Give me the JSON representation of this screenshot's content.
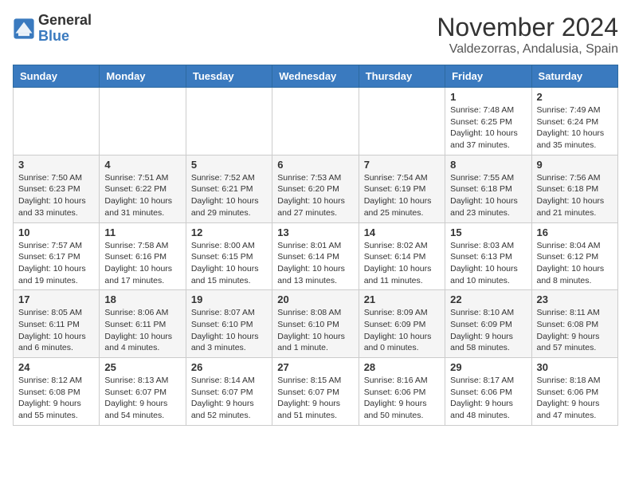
{
  "logo": {
    "general": "General",
    "blue": "Blue"
  },
  "title": {
    "month": "November 2024",
    "location": "Valdezorras, Andalusia, Spain"
  },
  "headers": [
    "Sunday",
    "Monday",
    "Tuesday",
    "Wednesday",
    "Thursday",
    "Friday",
    "Saturday"
  ],
  "weeks": [
    [
      {
        "day": "",
        "info": ""
      },
      {
        "day": "",
        "info": ""
      },
      {
        "day": "",
        "info": ""
      },
      {
        "day": "",
        "info": ""
      },
      {
        "day": "",
        "info": ""
      },
      {
        "day": "1",
        "info": "Sunrise: 7:48 AM\nSunset: 6:25 PM\nDaylight: 10 hours and 37 minutes."
      },
      {
        "day": "2",
        "info": "Sunrise: 7:49 AM\nSunset: 6:24 PM\nDaylight: 10 hours and 35 minutes."
      }
    ],
    [
      {
        "day": "3",
        "info": "Sunrise: 7:50 AM\nSunset: 6:23 PM\nDaylight: 10 hours and 33 minutes."
      },
      {
        "day": "4",
        "info": "Sunrise: 7:51 AM\nSunset: 6:22 PM\nDaylight: 10 hours and 31 minutes."
      },
      {
        "day": "5",
        "info": "Sunrise: 7:52 AM\nSunset: 6:21 PM\nDaylight: 10 hours and 29 minutes."
      },
      {
        "day": "6",
        "info": "Sunrise: 7:53 AM\nSunset: 6:20 PM\nDaylight: 10 hours and 27 minutes."
      },
      {
        "day": "7",
        "info": "Sunrise: 7:54 AM\nSunset: 6:19 PM\nDaylight: 10 hours and 25 minutes."
      },
      {
        "day": "8",
        "info": "Sunrise: 7:55 AM\nSunset: 6:18 PM\nDaylight: 10 hours and 23 minutes."
      },
      {
        "day": "9",
        "info": "Sunrise: 7:56 AM\nSunset: 6:18 PM\nDaylight: 10 hours and 21 minutes."
      }
    ],
    [
      {
        "day": "10",
        "info": "Sunrise: 7:57 AM\nSunset: 6:17 PM\nDaylight: 10 hours and 19 minutes."
      },
      {
        "day": "11",
        "info": "Sunrise: 7:58 AM\nSunset: 6:16 PM\nDaylight: 10 hours and 17 minutes."
      },
      {
        "day": "12",
        "info": "Sunrise: 8:00 AM\nSunset: 6:15 PM\nDaylight: 10 hours and 15 minutes."
      },
      {
        "day": "13",
        "info": "Sunrise: 8:01 AM\nSunset: 6:14 PM\nDaylight: 10 hours and 13 minutes."
      },
      {
        "day": "14",
        "info": "Sunrise: 8:02 AM\nSunset: 6:14 PM\nDaylight: 10 hours and 11 minutes."
      },
      {
        "day": "15",
        "info": "Sunrise: 8:03 AM\nSunset: 6:13 PM\nDaylight: 10 hours and 10 minutes."
      },
      {
        "day": "16",
        "info": "Sunrise: 8:04 AM\nSunset: 6:12 PM\nDaylight: 10 hours and 8 minutes."
      }
    ],
    [
      {
        "day": "17",
        "info": "Sunrise: 8:05 AM\nSunset: 6:11 PM\nDaylight: 10 hours and 6 minutes."
      },
      {
        "day": "18",
        "info": "Sunrise: 8:06 AM\nSunset: 6:11 PM\nDaylight: 10 hours and 4 minutes."
      },
      {
        "day": "19",
        "info": "Sunrise: 8:07 AM\nSunset: 6:10 PM\nDaylight: 10 hours and 3 minutes."
      },
      {
        "day": "20",
        "info": "Sunrise: 8:08 AM\nSunset: 6:10 PM\nDaylight: 10 hours and 1 minute."
      },
      {
        "day": "21",
        "info": "Sunrise: 8:09 AM\nSunset: 6:09 PM\nDaylight: 10 hours and 0 minutes."
      },
      {
        "day": "22",
        "info": "Sunrise: 8:10 AM\nSunset: 6:09 PM\nDaylight: 9 hours and 58 minutes."
      },
      {
        "day": "23",
        "info": "Sunrise: 8:11 AM\nSunset: 6:08 PM\nDaylight: 9 hours and 57 minutes."
      }
    ],
    [
      {
        "day": "24",
        "info": "Sunrise: 8:12 AM\nSunset: 6:08 PM\nDaylight: 9 hours and 55 minutes."
      },
      {
        "day": "25",
        "info": "Sunrise: 8:13 AM\nSunset: 6:07 PM\nDaylight: 9 hours and 54 minutes."
      },
      {
        "day": "26",
        "info": "Sunrise: 8:14 AM\nSunset: 6:07 PM\nDaylight: 9 hours and 52 minutes."
      },
      {
        "day": "27",
        "info": "Sunrise: 8:15 AM\nSunset: 6:07 PM\nDaylight: 9 hours and 51 minutes."
      },
      {
        "day": "28",
        "info": "Sunrise: 8:16 AM\nSunset: 6:06 PM\nDaylight: 9 hours and 50 minutes."
      },
      {
        "day": "29",
        "info": "Sunrise: 8:17 AM\nSunset: 6:06 PM\nDaylight: 9 hours and 48 minutes."
      },
      {
        "day": "30",
        "info": "Sunrise: 8:18 AM\nSunset: 6:06 PM\nDaylight: 9 hours and 47 minutes."
      }
    ]
  ]
}
